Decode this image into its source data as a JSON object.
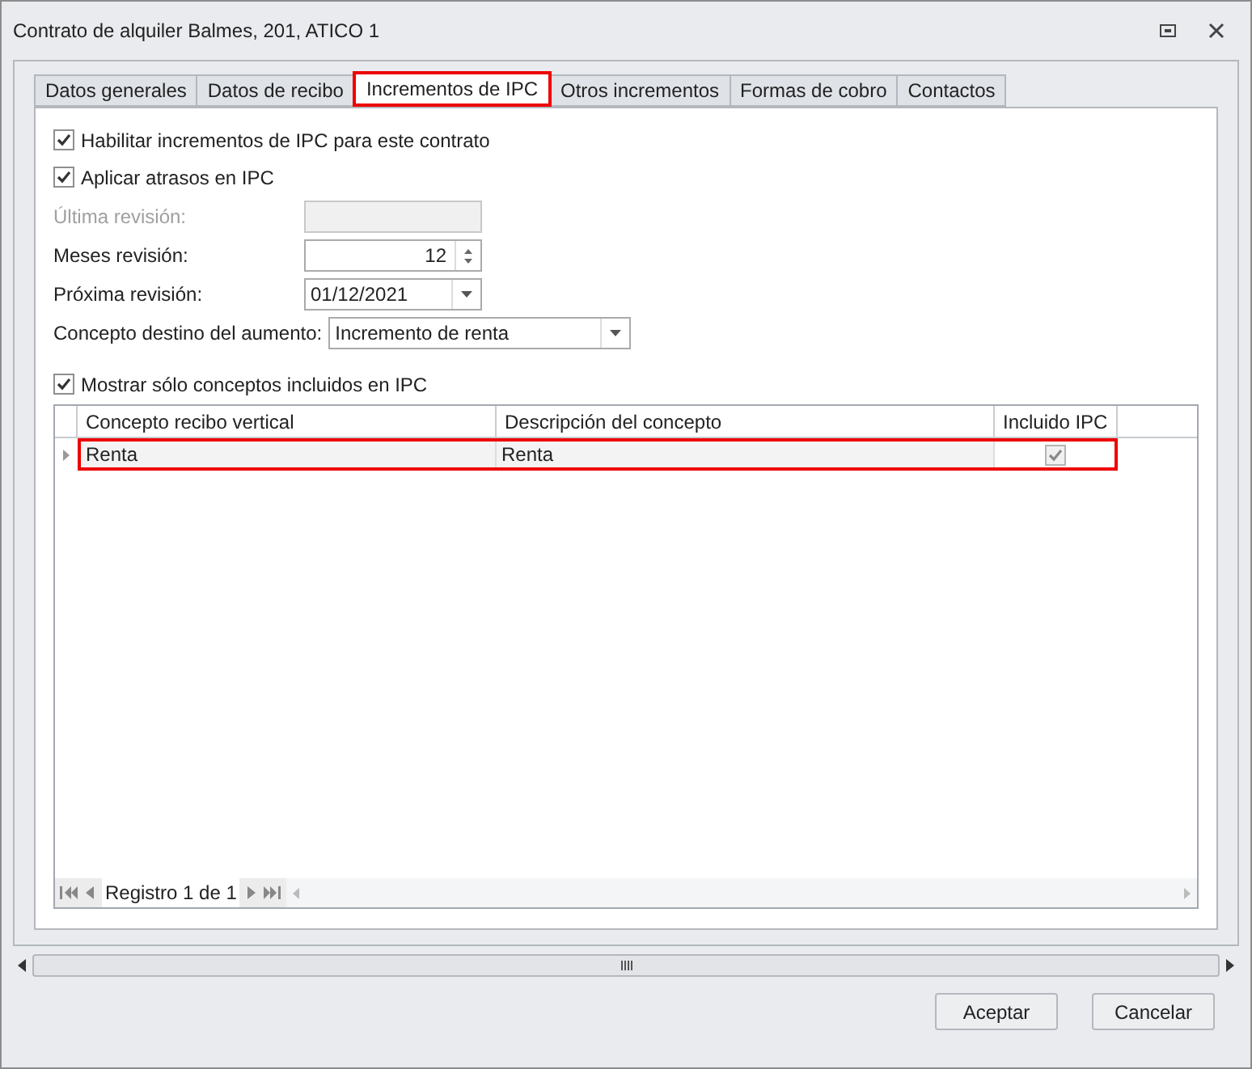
{
  "window": {
    "title": "Contrato de alquiler Balmes, 201, ATICO 1"
  },
  "tabs": [
    {
      "label": "Datos generales",
      "selected": false
    },
    {
      "label": "Datos de recibo",
      "selected": false
    },
    {
      "label": "Incrementos de IPC",
      "selected": true
    },
    {
      "label": "Otros incrementos",
      "selected": false
    },
    {
      "label": "Formas de cobro",
      "selected": false
    },
    {
      "label": "Contactos",
      "selected": false
    }
  ],
  "options": [
    {
      "label": "Habilitar incrementos de IPC para este contrato",
      "checked": true
    },
    {
      "label": "Aplicar atrasos en IPC",
      "checked": true
    }
  ],
  "fields": [
    {
      "kind": "text",
      "label": "Última revisión:",
      "disabled": true
    },
    {
      "kind": "spin",
      "label": "Meses revisión:",
      "value": "12",
      "disabled": false
    },
    {
      "kind": "date",
      "label": "Próxima revisión:",
      "value": "01/12/2021",
      "disabled": false
    },
    {
      "kind": "combo",
      "label": "Concepto destino del aumento:",
      "value": "Incremento de renta",
      "disabled": false
    }
  ],
  "filter": {
    "label": "Mostrar sólo conceptos incluidos en IPC",
    "checked": true
  },
  "table": {
    "columns": [
      "Concepto recibo vertical",
      "Descripción del concepto",
      "Incluido IPC"
    ],
    "rows": [
      {
        "cells": [
          "Renta",
          "Renta"
        ],
        "included": true,
        "selected": true
      }
    ]
  },
  "navigator": {
    "text": "Registro 1 de 1"
  },
  "buttons": [
    "Aceptar",
    "Cancelar"
  ]
}
